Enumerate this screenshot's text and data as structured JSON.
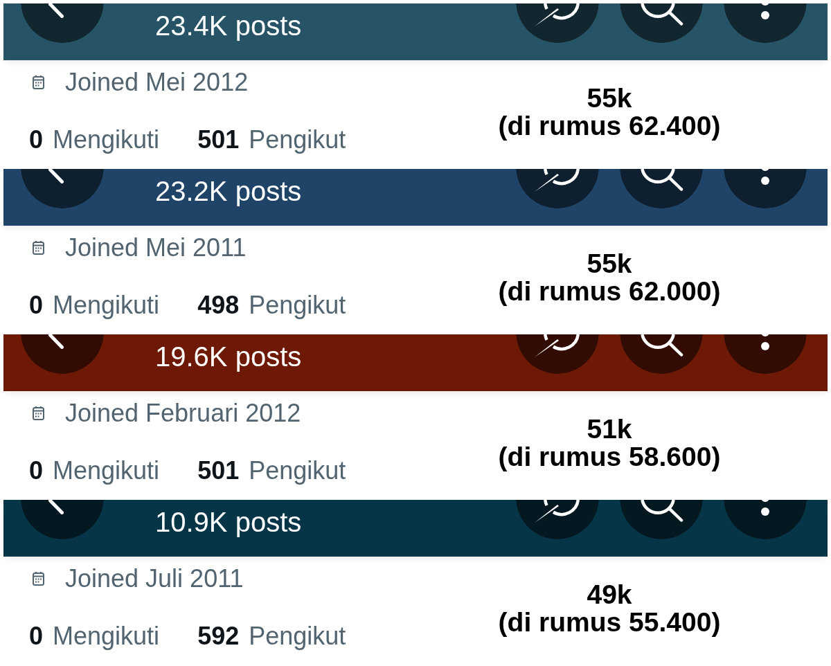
{
  "profiles": [
    {
      "header": {
        "color": "#265466",
        "posts": "23.4K posts"
      },
      "joined": "Joined Mei 2012",
      "following": {
        "count": "0",
        "label": "Mengikuti"
      },
      "followers": {
        "count": "501",
        "label": "Pengikut"
      },
      "note": {
        "value": "55k",
        "formula": "(di rumus 62.400)"
      }
    },
    {
      "header": {
        "color": "#1f4468",
        "posts": "23.2K posts"
      },
      "joined": "Joined Mei 2011",
      "following": {
        "count": "0",
        "label": "Mengikuti"
      },
      "followers": {
        "count": "498",
        "label": "Pengikut"
      },
      "note": {
        "value": "55k",
        "formula": "(di rumus 62.000)"
      }
    },
    {
      "header": {
        "color": "#6e1905",
        "posts": "19.6K posts"
      },
      "joined": "Joined Februari 2012",
      "following": {
        "count": "0",
        "label": "Mengikuti"
      },
      "followers": {
        "count": "501",
        "label": "Pengikut"
      },
      "note": {
        "value": "51k",
        "formula": "(di rumus 58.600)"
      }
    },
    {
      "header": {
        "color": "#063548",
        "posts": "10.9K posts"
      },
      "joined": "Joined Juli 2011",
      "following": {
        "count": "0",
        "label": "Mengikuti"
      },
      "followers": {
        "count": "592",
        "label": "Pengikut"
      },
      "note": {
        "value": "49k",
        "formula": "(di rumus 55.400)"
      }
    }
  ]
}
